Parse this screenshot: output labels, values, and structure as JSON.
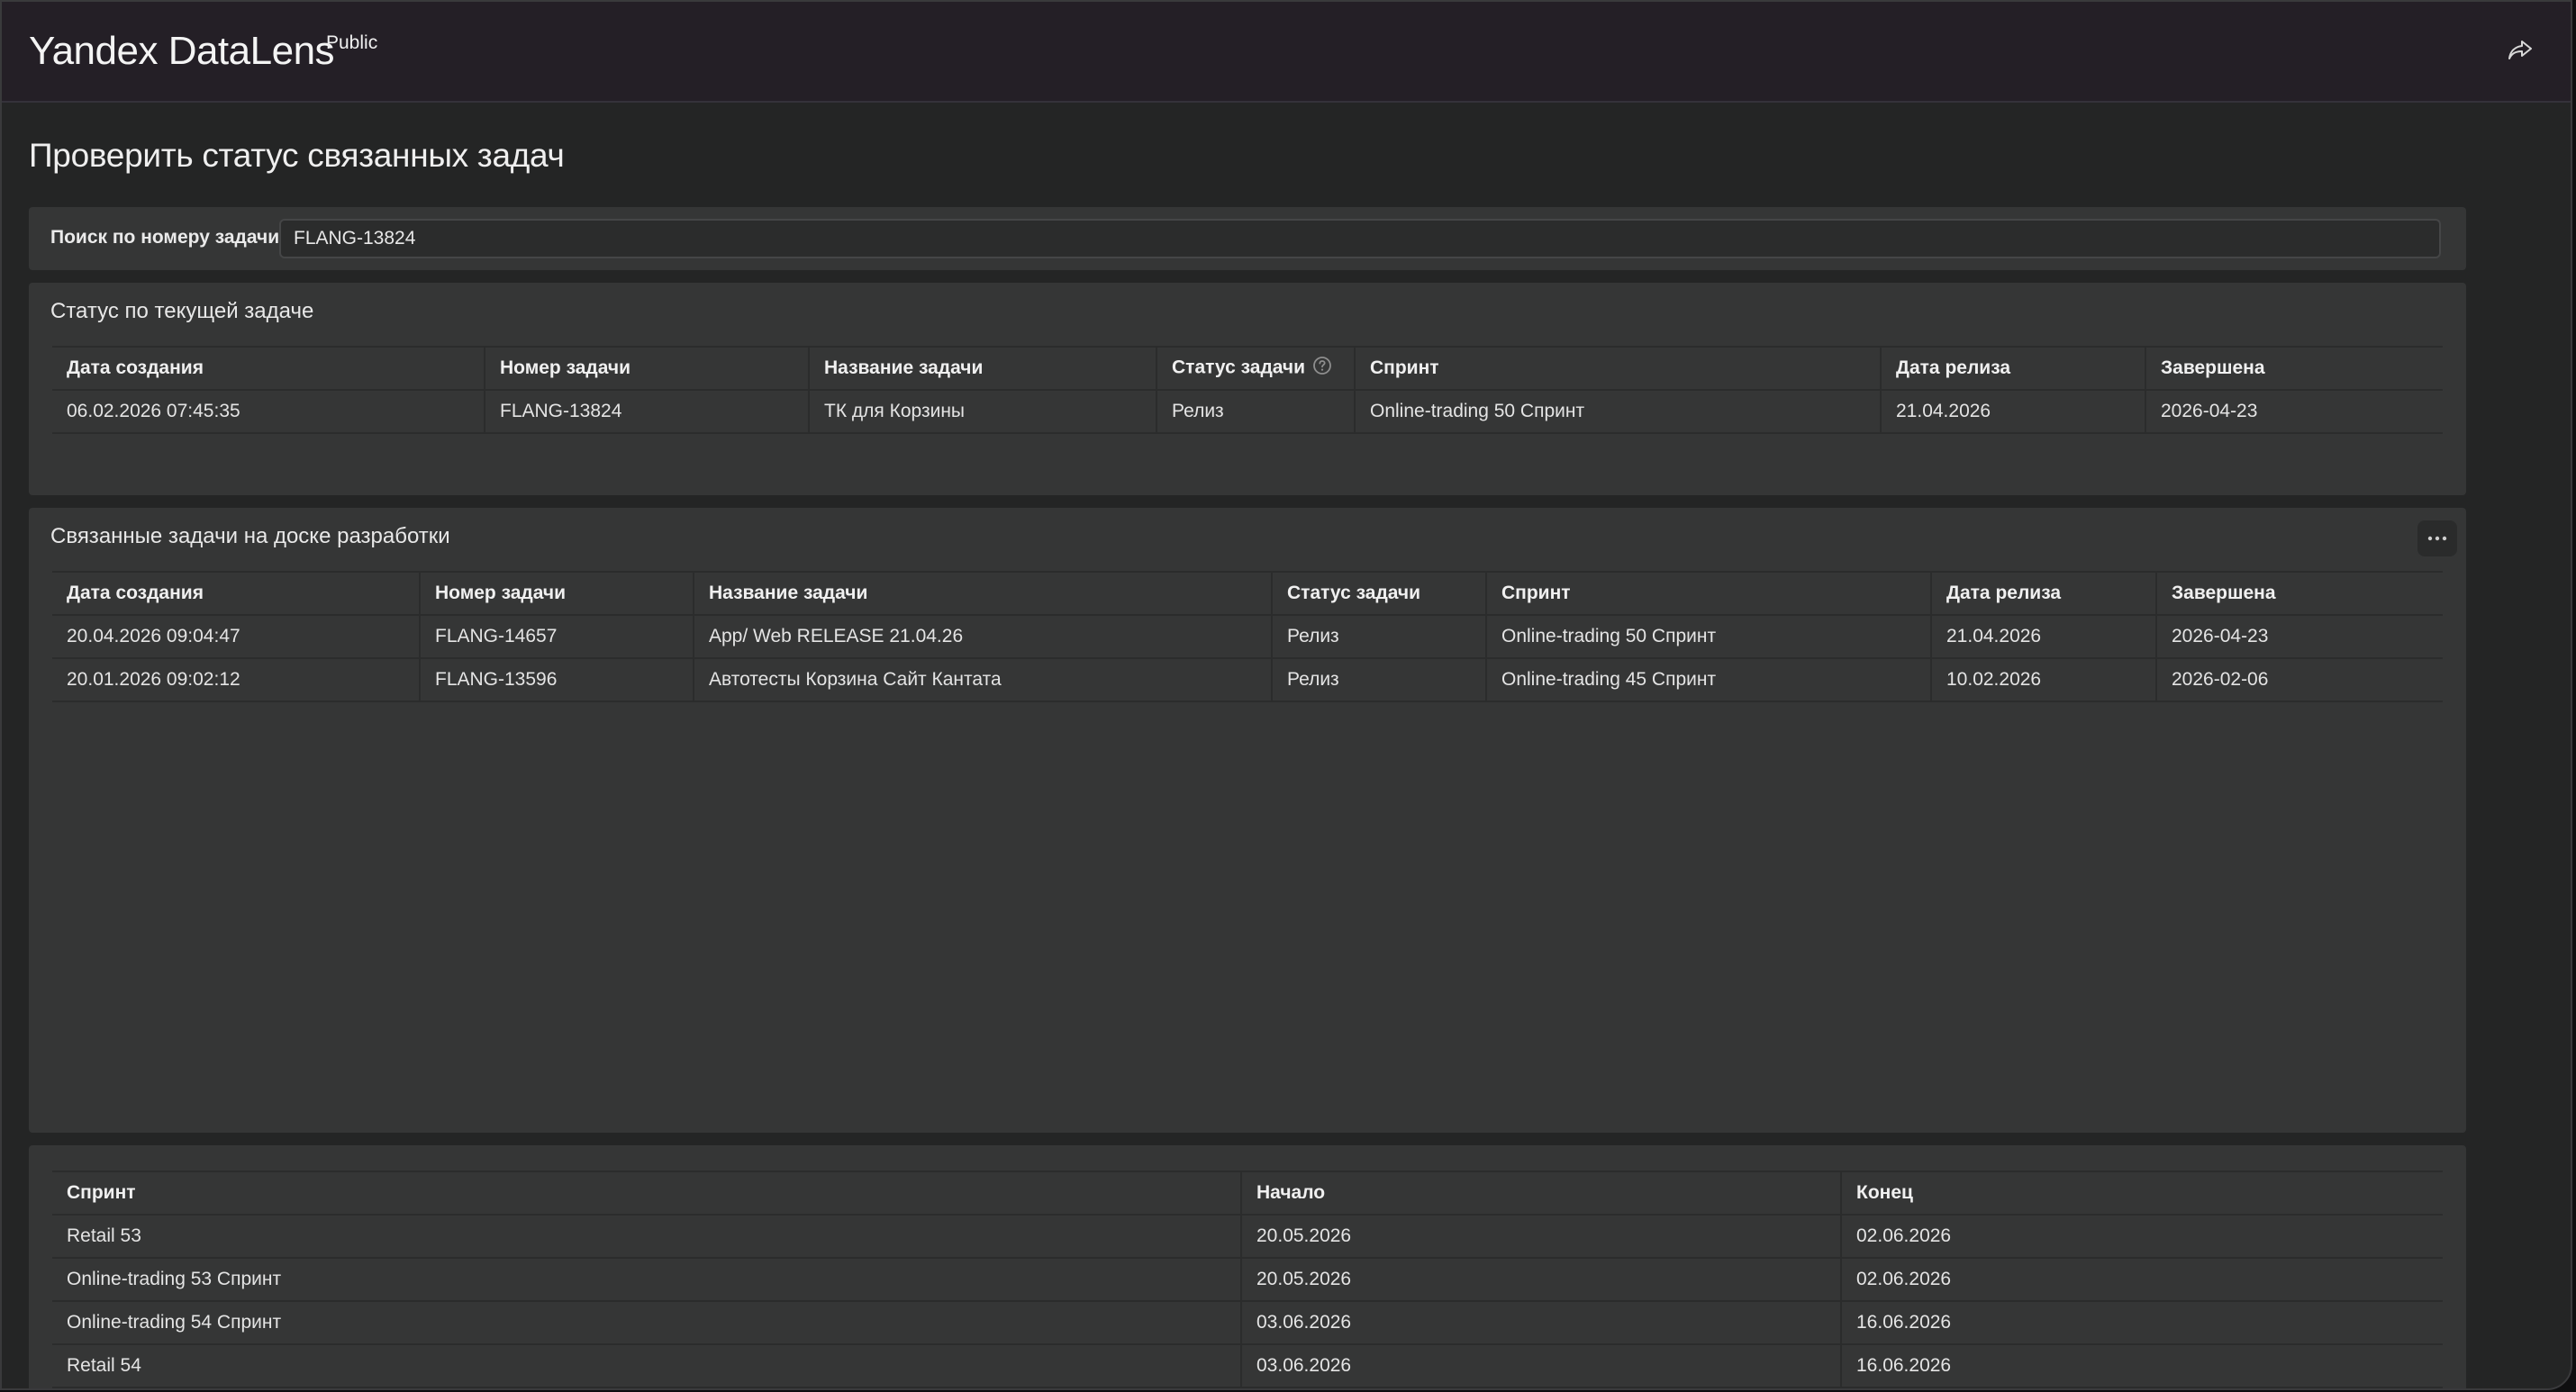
{
  "header": {
    "brand": "Yandex DataLens",
    "badge": "Public",
    "share_icon": "share-icon"
  },
  "page": {
    "title": "Проверить статус связанных задач"
  },
  "search": {
    "label": "Поиск по номеру задачи",
    "value": "FLANG-13824"
  },
  "current": {
    "title": "Статус по текущей задаче",
    "columns": [
      "Дата создания",
      "Номер задачи",
      "Название задачи",
      "Статус задачи",
      "Спринт",
      "Дата релиза",
      "Завершена"
    ],
    "rows": [
      [
        "06.02.2026 07:45:35",
        "FLANG-13824",
        "ТК для Корзины",
        "Релиз",
        "Online-trading 50 Спринт",
        "21.04.2026",
        "2026-04-23"
      ]
    ]
  },
  "linked": {
    "title": "Связанные задачи на доске разработки",
    "menu_icon": "more-horizontal-icon",
    "columns": [
      "Дата создания",
      "Номер задачи",
      "Название задачи",
      "Статус задачи",
      "Спринт",
      "Дата релиза",
      "Завершена"
    ],
    "rows": [
      [
        "20.04.2026 09:04:47",
        "FLANG-14657",
        "App/ Web RELEASE 21.04.26",
        "Релиз",
        "Online-trading 50 Спринт",
        "21.04.2026",
        "2026-04-23"
      ],
      [
        "20.01.2026 09:02:12",
        "FLANG-13596",
        "Автотесты Корзина Сайт Кантата",
        "Релиз",
        "Online-trading 45 Спринт",
        "10.02.2026",
        "2026-02-06"
      ]
    ]
  },
  "sprints": {
    "columns": [
      "Спринт",
      "Начало",
      "Конец"
    ],
    "rows": [
      [
        "Retail 53",
        "20.05.2026",
        "02.06.2026"
      ],
      [
        "Online-trading 53 Спринт",
        "20.05.2026",
        "02.06.2026"
      ],
      [
        "Online-trading 54 Спринт",
        "03.06.2026",
        "16.06.2026"
      ],
      [
        "Retail 54",
        "03.06.2026",
        "16.06.2026"
      ]
    ]
  }
}
